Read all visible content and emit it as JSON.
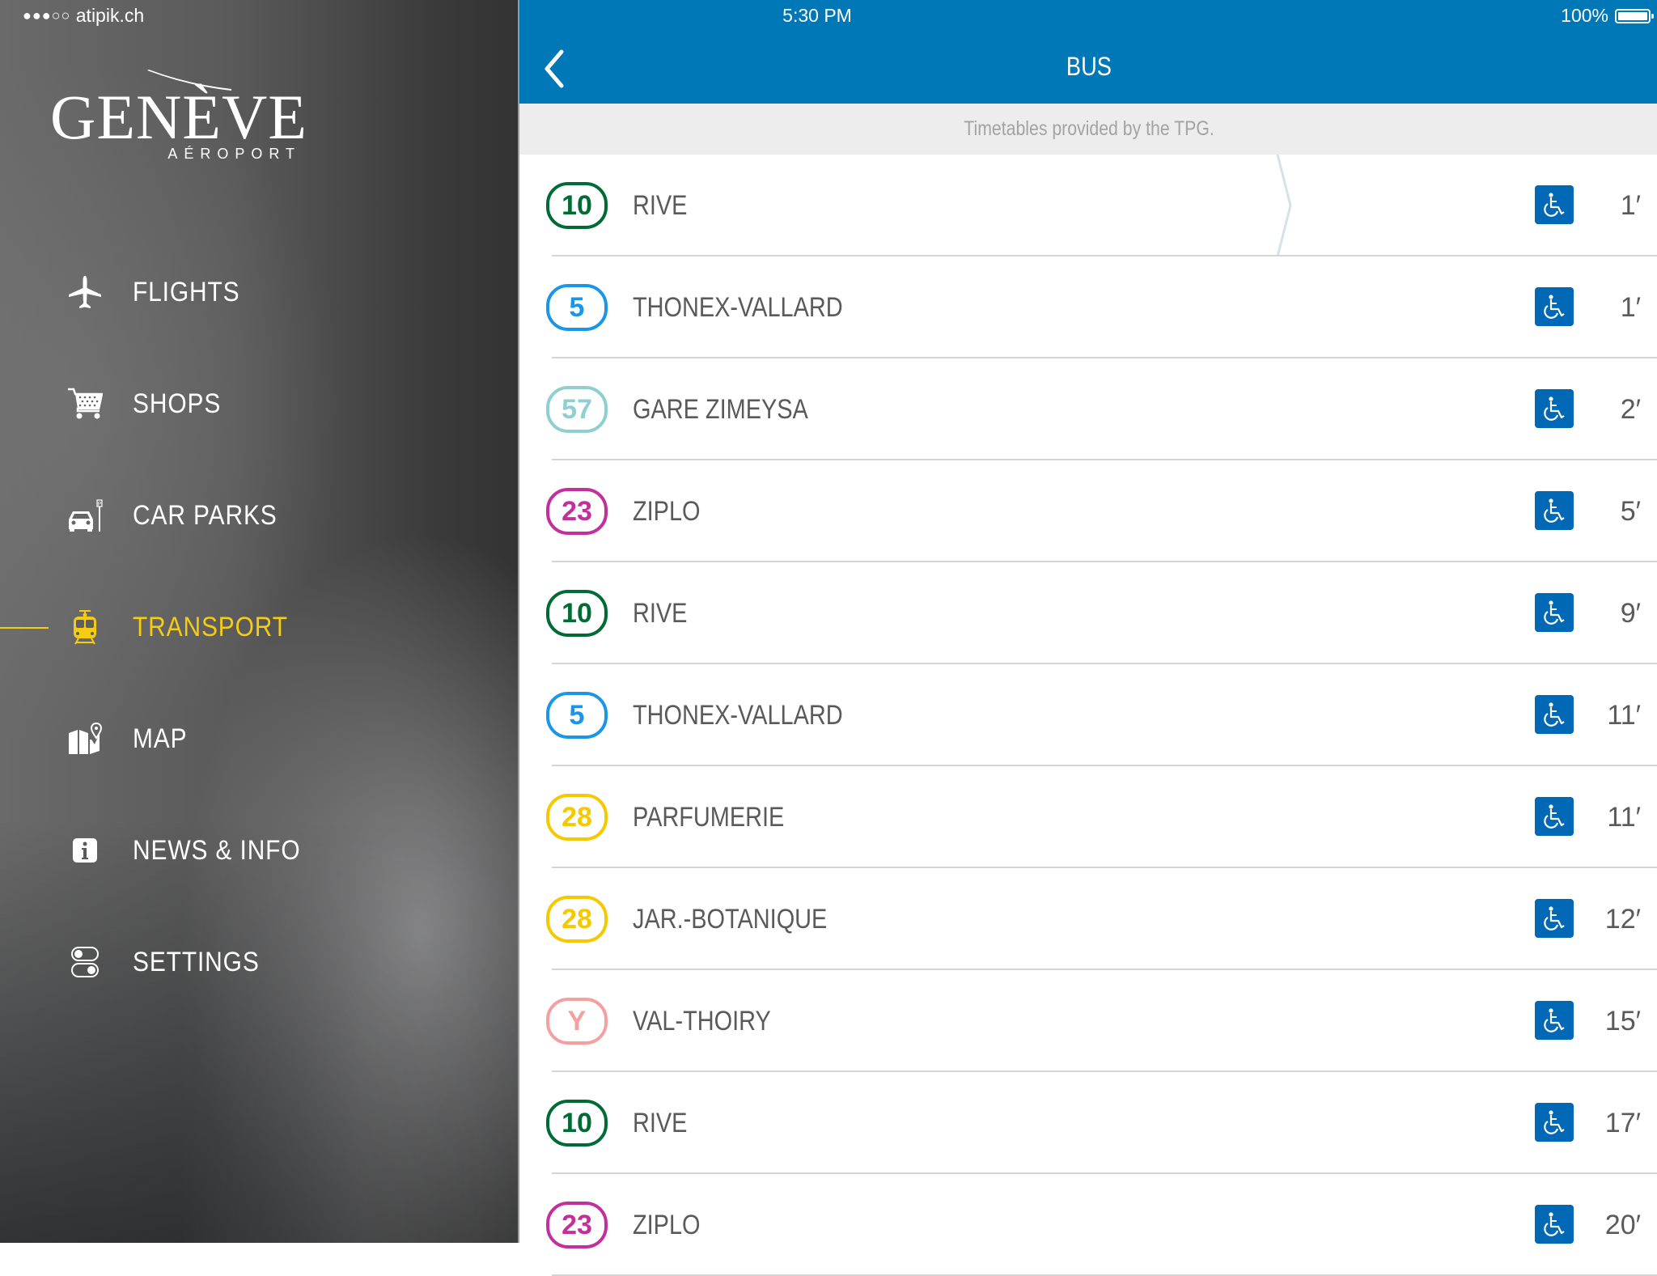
{
  "status_bar": {
    "carrier": "atipik.ch",
    "signal": "●●●○○",
    "time": "5:30 PM",
    "battery": "100%",
    "battery_level_percent": 100
  },
  "sidebar": {
    "logo": {
      "main": "GENÈVE",
      "sub": "AÉROPORT"
    },
    "items": [
      {
        "label": "FLIGHTS",
        "icon": "airplane-icon",
        "active": false
      },
      {
        "label": "SHOPS",
        "icon": "shopping-cart-icon",
        "active": false
      },
      {
        "label": "CAR PARKS",
        "icon": "car-park-icon",
        "active": false
      },
      {
        "label": "TRANSPORT",
        "icon": "train-icon",
        "active": true
      },
      {
        "label": "MAP",
        "icon": "map-pin-icon",
        "active": false
      },
      {
        "label": "NEWS & INFO",
        "icon": "info-icon",
        "active": false
      },
      {
        "label": "SETTINGS",
        "icon": "toggle-settings-icon",
        "active": false
      }
    ],
    "active_color": "#f5cc10"
  },
  "header": {
    "title": "BUS",
    "back_icon": "chevron-left-icon",
    "subtitle": "Timetables provided by the TPG.",
    "color": "#0077b6"
  },
  "departures": [
    {
      "line": "10",
      "color": "#006b35",
      "destination": "RIVE",
      "accessible": true,
      "wait": "1′"
    },
    {
      "line": "5",
      "color": "#1a96e8",
      "destination": "THONEX-VALLARD",
      "accessible": true,
      "wait": "1′"
    },
    {
      "line": "57",
      "color": "#8fcfcf",
      "destination": "GARE ZIMEYSA",
      "accessible": true,
      "wait": "2′"
    },
    {
      "line": "23",
      "color": "#c4309b",
      "destination": "ZIPLO",
      "accessible": true,
      "wait": "5′"
    },
    {
      "line": "10",
      "color": "#006b35",
      "destination": "RIVE",
      "accessible": true,
      "wait": "9′"
    },
    {
      "line": "5",
      "color": "#1a96e8",
      "destination": "THONEX-VALLARD",
      "accessible": true,
      "wait": "11′"
    },
    {
      "line": "28",
      "color": "#f5c800",
      "destination": "PARFUMERIE",
      "accessible": true,
      "wait": "11′"
    },
    {
      "line": "28",
      "color": "#f5c800",
      "destination": "JAR.-BOTANIQUE",
      "accessible": true,
      "wait": "12′"
    },
    {
      "line": "Y",
      "color": "#f5a0a0",
      "destination": "VAL-THOIRY",
      "accessible": true,
      "wait": "15′"
    },
    {
      "line": "10",
      "color": "#006b35",
      "destination": "RIVE",
      "accessible": true,
      "wait": "17′"
    },
    {
      "line": "23",
      "color": "#c4309b",
      "destination": "ZIPLO",
      "accessible": true,
      "wait": "20′"
    }
  ],
  "accessible_icon": "wheelchair-icon",
  "accessible_color": "#0068b5"
}
